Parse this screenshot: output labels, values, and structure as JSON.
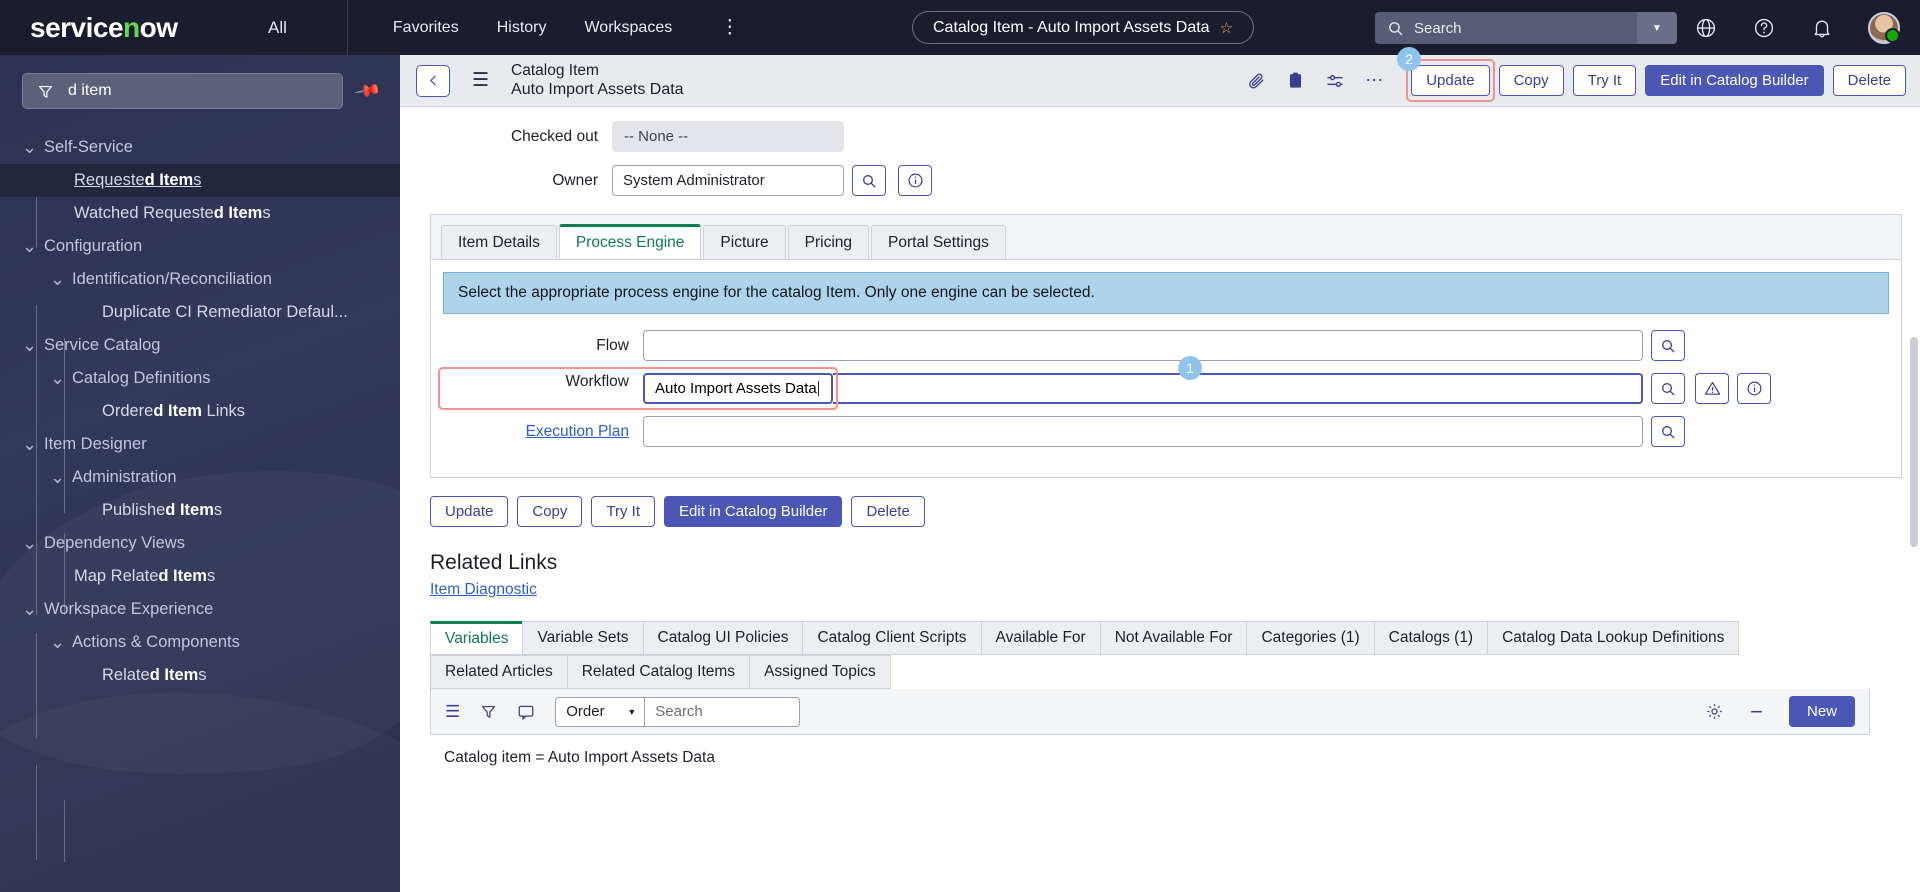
{
  "topnav": {
    "logo_text": "servicenow",
    "all_label": "All",
    "links": [
      "Favorites",
      "History",
      "Workspaces"
    ],
    "kebab": "⋮",
    "record_pill": "Catalog Item - Auto Import Assets Data",
    "star_icon": "star-icon",
    "search_placeholder": "Search",
    "icons": [
      "globe-icon",
      "help-icon",
      "bell-icon",
      "avatar"
    ]
  },
  "sidebar": {
    "filter_value": "d item",
    "filter_icon": "filter-icon",
    "pin_icon": "pin-icon",
    "items": [
      {
        "label": "Self-Service",
        "level": 0,
        "chevron": true,
        "hit": "",
        "active": false
      },
      {
        "label": "Requested Items",
        "level": 2,
        "chevron": false,
        "hit": "d Item",
        "active": true
      },
      {
        "label": "Watched Requested Items",
        "level": 2,
        "chevron": false,
        "hit": "d Item",
        "active": false
      },
      {
        "label": "Configuration",
        "level": 0,
        "chevron": true,
        "hit": "",
        "active": false
      },
      {
        "label": "Identification/Reconciliation",
        "level": 1,
        "chevron": true,
        "hit": "",
        "active": false
      },
      {
        "label": "Duplicate CI Remediator Defaul...",
        "level": 3,
        "chevron": false,
        "hit": "",
        "active": false
      },
      {
        "label": "Service Catalog",
        "level": 0,
        "chevron": true,
        "hit": "",
        "active": false
      },
      {
        "label": "Catalog Definitions",
        "level": 1,
        "chevron": true,
        "hit": "",
        "active": false
      },
      {
        "label": "Ordered Item Links",
        "level": 3,
        "chevron": false,
        "hit": "d Item",
        "active": false
      },
      {
        "label": "Item Designer",
        "level": 0,
        "chevron": true,
        "hit": "",
        "active": false
      },
      {
        "label": "Administration",
        "level": 1,
        "chevron": true,
        "hit": "",
        "active": false
      },
      {
        "label": "Published Items",
        "level": 3,
        "chevron": false,
        "hit": "d Item",
        "active": false
      },
      {
        "label": "Dependency Views",
        "level": 0,
        "chevron": true,
        "hit": "",
        "active": false
      },
      {
        "label": "Map Related Items",
        "level": 2,
        "chevron": false,
        "hit": "d Item",
        "active": false
      },
      {
        "label": "Workspace Experience",
        "level": 0,
        "chevron": true,
        "hit": "",
        "active": false
      },
      {
        "label": "Actions & Components",
        "level": 1,
        "chevron": true,
        "hit": "",
        "active": false
      },
      {
        "label": "Related Items",
        "level": 3,
        "chevron": false,
        "hit": "d Item",
        "active": false
      }
    ]
  },
  "form_header": {
    "back_icon": "chevron-left-icon",
    "menu_icon": "hamburger-icon",
    "record_type": "Catalog Item",
    "record_name": "Auto Import Assets Data",
    "icons": [
      "attachment-icon",
      "clipboard-icon",
      "personalize-icon",
      "more-icon"
    ],
    "buttons": [
      {
        "label": "Update",
        "primary": false,
        "highlight": true,
        "badge": "2"
      },
      {
        "label": "Copy",
        "primary": false,
        "highlight": false
      },
      {
        "label": "Try It",
        "primary": false,
        "highlight": false
      },
      {
        "label": "Edit in Catalog Builder",
        "primary": true,
        "highlight": false
      },
      {
        "label": "Delete",
        "primary": false,
        "highlight": false
      }
    ]
  },
  "form_fields": {
    "checked_out_label": "Checked out",
    "checked_out_value": "-- None --",
    "owner_label": "Owner",
    "owner_value": "System Administrator",
    "search_icon": "magnifier-icon",
    "info_icon": "info-icon"
  },
  "tabs": [
    {
      "label": "Item Details",
      "active": false
    },
    {
      "label": "Process Engine",
      "active": true
    },
    {
      "label": "Picture",
      "active": false
    },
    {
      "label": "Pricing",
      "active": false
    },
    {
      "label": "Portal Settings",
      "active": false
    }
  ],
  "process_engine": {
    "banner": "Select the appropriate process engine for the catalog Item. Only one engine can be selected.",
    "flow_label": "Flow",
    "flow_value": "",
    "workflow_label": "Workflow",
    "workflow_value": "Auto Import Assets Data",
    "workflow_badge": "1",
    "execution_plan_label": "Execution Plan",
    "execution_plan_value": "",
    "warning_icon": "warning-icon",
    "info_icon": "info-icon",
    "search_icon": "magnifier-icon"
  },
  "bottom_buttons": [
    {
      "label": "Update",
      "primary": false
    },
    {
      "label": "Copy",
      "primary": false
    },
    {
      "label": "Try It",
      "primary": false
    },
    {
      "label": "Edit in Catalog Builder",
      "primary": true
    },
    {
      "label": "Delete",
      "primary": false
    }
  ],
  "related_links": {
    "title": "Related Links",
    "link": "Item Diagnostic"
  },
  "related_tabs": [
    {
      "label": "Variables",
      "active": true
    },
    {
      "label": "Variable Sets",
      "active": false
    },
    {
      "label": "Catalog UI Policies",
      "active": false
    },
    {
      "label": "Catalog Client Scripts",
      "active": false
    },
    {
      "label": "Available For",
      "active": false
    },
    {
      "label": "Not Available For",
      "active": false
    },
    {
      "label": "Categories (1)",
      "active": false
    },
    {
      "label": "Catalogs (1)",
      "active": false
    },
    {
      "label": "Catalog Data Lookup Definitions",
      "active": false
    },
    {
      "label": "Related Articles",
      "active": false
    },
    {
      "label": "Related Catalog Items",
      "active": false
    },
    {
      "label": "Assigned Topics",
      "active": false
    }
  ],
  "list_toolbar": {
    "menu_icon": "list-menu-icon",
    "filter_icon": "funnel-icon",
    "comment_icon": "speech-icon",
    "order_label": "Order",
    "search_placeholder": "Search",
    "gear_icon": "gear-icon",
    "collapse_icon": "minus-icon",
    "new_label": "New"
  },
  "filter_line": "Catalog item = Auto Import Assets Data"
}
